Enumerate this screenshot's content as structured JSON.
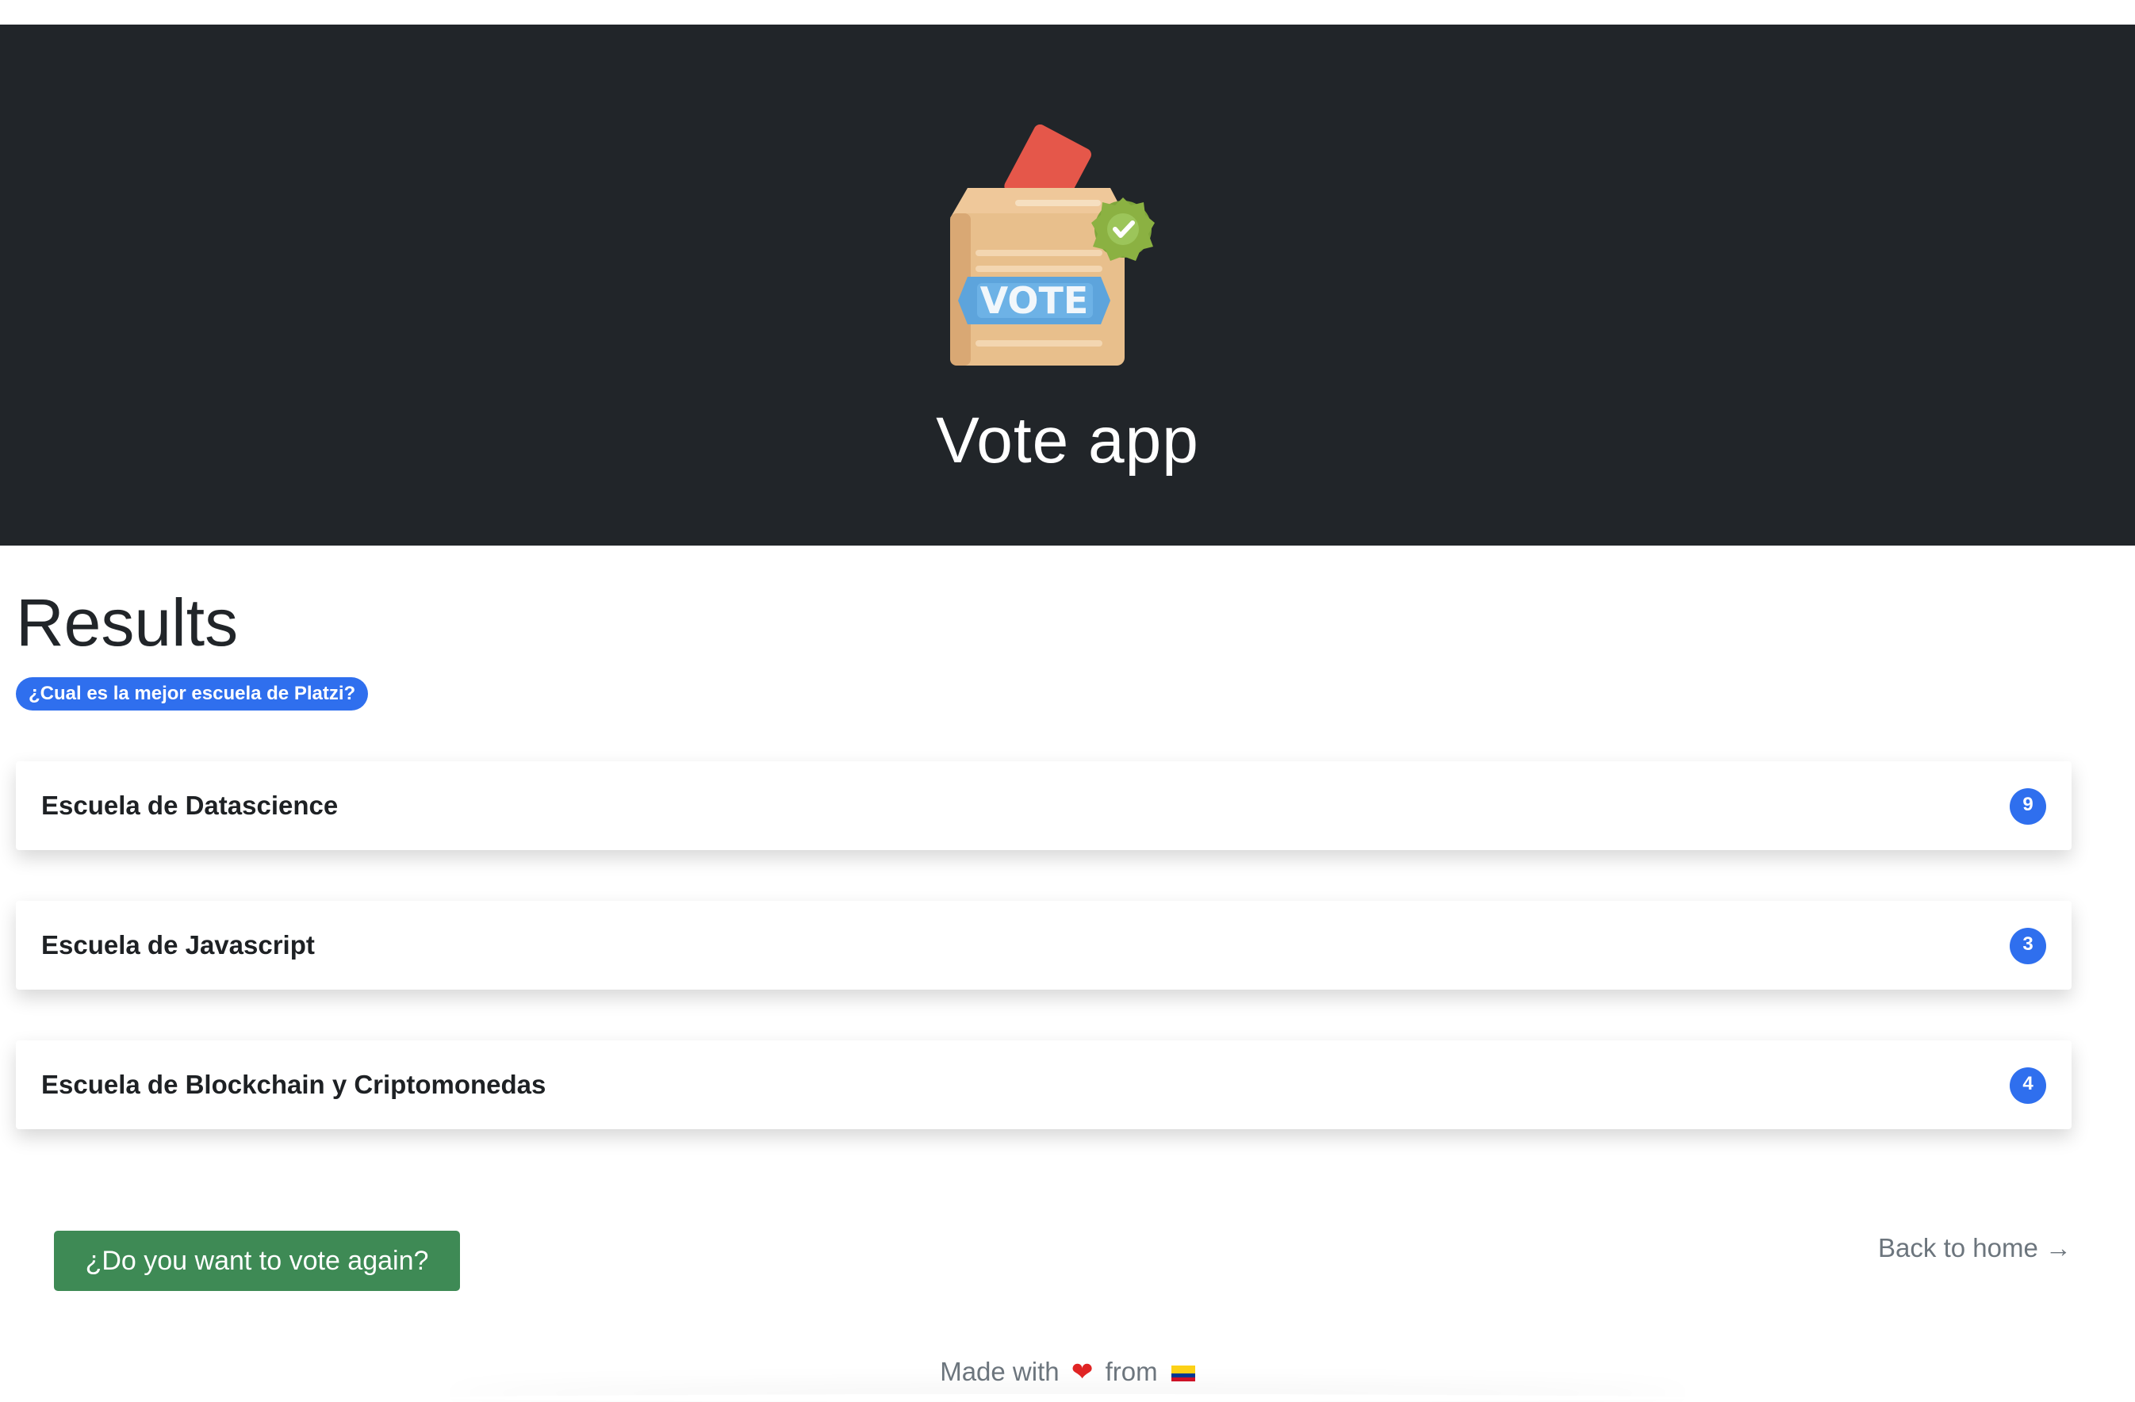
{
  "hero": {
    "title": "Vote app",
    "logo_text": "VOTE"
  },
  "results": {
    "title": "Results",
    "question": "¿Cual es la mejor escuela de Platzi?",
    "items": [
      {
        "name": "Escuela de Datascience",
        "votes": "9"
      },
      {
        "name": "Escuela de Javascript",
        "votes": "3"
      },
      {
        "name": "Escuela de Blockchain y Criptomonedas",
        "votes": "4"
      }
    ]
  },
  "actions": {
    "vote_again_label": "¿Do you want to vote again?",
    "back_home_label": "Back to home →"
  },
  "footer": {
    "made_with": "Made with",
    "heart": "❤",
    "from": "from",
    "flag_icon": "colombia-flag-icon"
  },
  "colors": {
    "hero_bg": "#212529",
    "accent": "#2f6fee",
    "success": "#3e8a55"
  }
}
